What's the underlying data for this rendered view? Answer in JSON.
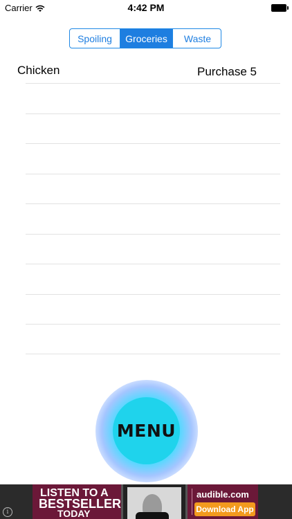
{
  "status_bar": {
    "carrier": "Carrier",
    "time": "4:42 PM"
  },
  "segmented": {
    "tabs": [
      {
        "label": "Spoiling"
      },
      {
        "label": "Groceries"
      },
      {
        "label": "Waste"
      }
    ],
    "selected": "Groceries",
    "accent_color": "#1e7ee0"
  },
  "list": {
    "rows": [
      {
        "name": "Chicken",
        "action": "Purchase 5"
      }
    ],
    "empty_rows": 9
  },
  "menu_button": {
    "label": "MENU",
    "color": "#1fd3ec"
  },
  "ad": {
    "line1": "LISTEN TO A",
    "line2": "BESTSELLER",
    "line3": "TODAY",
    "brand": "audible.com",
    "cta": "Download App",
    "info_glyph": "i"
  }
}
